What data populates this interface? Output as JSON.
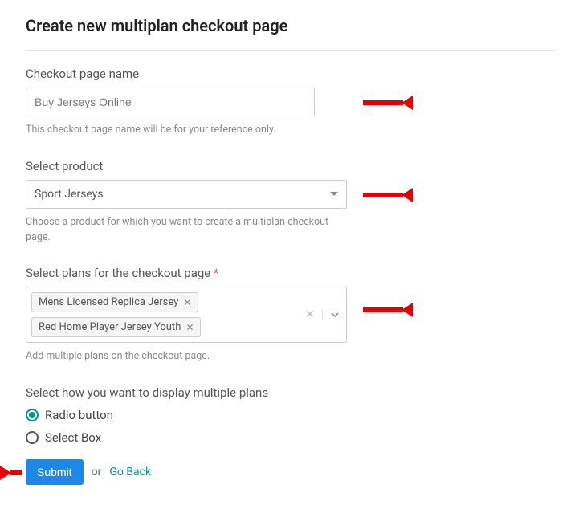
{
  "title": "Create new multiplan checkout page",
  "checkoutName": {
    "label": "Checkout page name",
    "value": "Buy Jerseys Online",
    "helper": "This checkout page name will be for your reference only."
  },
  "product": {
    "label": "Select product",
    "selected": "Sport Jerseys",
    "helper": "Choose a product for which you want to create a multiplan checkout page."
  },
  "plans": {
    "label": "Select plans for the checkout page",
    "selected": [
      "Mens Licensed Replica Jersey",
      "Red Home Player Jersey Youth"
    ],
    "helper": "Add multiple plans on the checkout page."
  },
  "display": {
    "label": "Select how you want to display multiple plans",
    "options": [
      "Radio button",
      "Select Box"
    ],
    "selected": "Radio button"
  },
  "actions": {
    "submit": "Submit",
    "or": "or",
    "goBack": "Go Back"
  }
}
